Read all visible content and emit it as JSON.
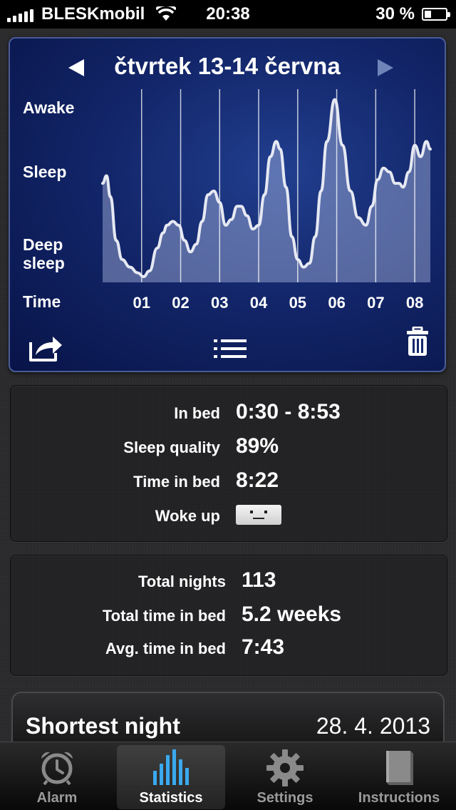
{
  "status_bar": {
    "carrier": "BLESKmobil",
    "time": "20:38",
    "battery": "30 %"
  },
  "graph": {
    "title": "čtvrtek 13-14 června",
    "y_labels": {
      "awake": "Awake",
      "sleep": "Sleep",
      "deep_line1": "Deep",
      "deep_line2": "sleep",
      "time": "Time"
    },
    "hours": [
      "01",
      "02",
      "03",
      "04",
      "05",
      "06",
      "07",
      "08"
    ]
  },
  "chart_data": {
    "type": "area",
    "x_unit": "hours",
    "x": [
      0.0,
      0.1,
      0.2,
      0.35,
      0.5,
      0.7,
      0.9,
      1.05,
      1.2,
      1.4,
      1.55,
      1.65,
      1.8,
      1.95,
      2.1,
      2.25,
      2.4,
      2.55,
      2.7,
      2.85,
      3.0,
      3.15,
      3.3,
      3.45,
      3.55,
      3.7,
      3.85,
      4.0,
      4.15,
      4.3,
      4.45,
      4.55,
      4.7,
      4.85,
      5.0,
      5.15,
      5.3,
      5.45,
      5.6,
      5.75,
      5.95,
      6.15,
      6.35,
      6.55,
      6.75,
      6.9,
      7.05,
      7.2,
      7.35,
      7.5,
      7.6,
      7.7,
      7.85,
      8.0,
      8.15,
      8.3,
      8.4
    ],
    "values": [
      0.52,
      0.56,
      0.45,
      0.22,
      0.12,
      0.08,
      0.05,
      0.03,
      0.06,
      0.18,
      0.26,
      0.3,
      0.32,
      0.3,
      0.22,
      0.16,
      0.2,
      0.32,
      0.46,
      0.48,
      0.42,
      0.3,
      0.33,
      0.4,
      0.4,
      0.35,
      0.28,
      0.3,
      0.46,
      0.66,
      0.74,
      0.7,
      0.5,
      0.24,
      0.12,
      0.08,
      0.1,
      0.24,
      0.48,
      0.74,
      0.96,
      0.72,
      0.48,
      0.34,
      0.3,
      0.4,
      0.54,
      0.6,
      0.58,
      0.52,
      0.52,
      0.5,
      0.58,
      0.72,
      0.66,
      0.74,
      0.7
    ],
    "ylim": [
      0,
      1
    ]
  },
  "stats": {
    "in_bed_label": "In bed",
    "in_bed_value": "0:30 - 8:53",
    "quality_label": "Sleep quality",
    "quality_value": "89%",
    "time_label": "Time in bed",
    "time_value": "8:22",
    "woke_label": "Woke up",
    "woke_icon": "neutral-face-icon"
  },
  "totals": {
    "nights_label": "Total nights",
    "nights_value": "113",
    "total_label": "Total time in bed",
    "total_value": "5.2 weeks",
    "avg_label": "Avg. time in bed",
    "avg_value": "7:43"
  },
  "shortest": {
    "title": "Shortest night",
    "date": "28. 4. 2013"
  },
  "tabs": [
    {
      "label": "Alarm",
      "icon": "alarm-clock-icon",
      "active": false
    },
    {
      "label": "Statistics",
      "icon": "bar-chart-icon",
      "active": true
    },
    {
      "label": "Settings",
      "icon": "gear-icon",
      "active": false
    },
    {
      "label": "Instructions",
      "icon": "book-icon",
      "active": false
    }
  ],
  "colors": {
    "accent": "#213f8f",
    "graph_line": "#e6e9f2",
    "tab_active_icon": "#3aa9ee"
  }
}
